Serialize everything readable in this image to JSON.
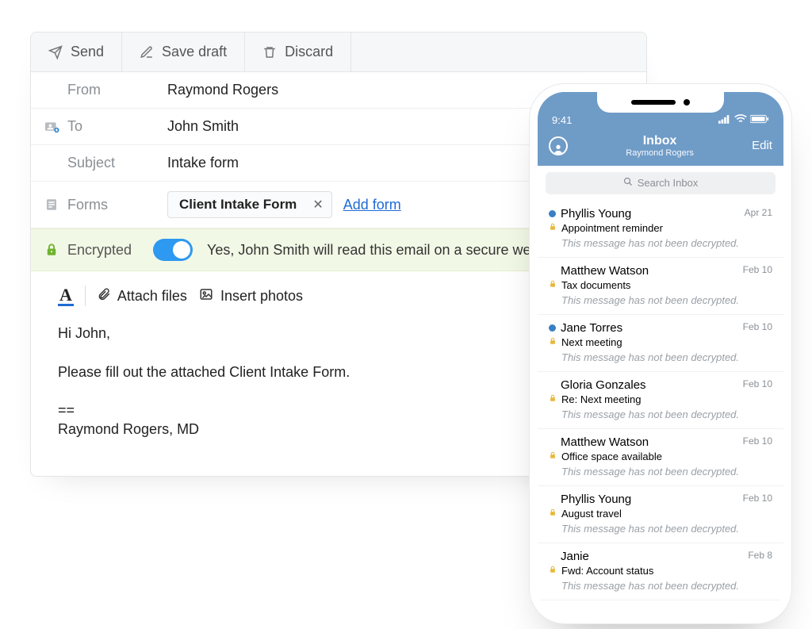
{
  "compose": {
    "toolbar": {
      "send": "Send",
      "save_draft": "Save draft",
      "discard": "Discard"
    },
    "labels": {
      "from": "From",
      "to": "To",
      "subject": "Subject",
      "forms": "Forms",
      "encrypted": "Encrypted"
    },
    "from_value": "Raymond Rogers",
    "to_value": "John Smith",
    "subject_value": "Intake form",
    "form_chip": "Client Intake Form",
    "add_form": "Add form",
    "encrypted_msg": "Yes, John Smith will read this email on a secure web pa",
    "editor": {
      "attach": "Attach files",
      "insert_photos": "Insert photos"
    },
    "body_line1": "Hi John,",
    "body_line2": "Please fill out the attached Client Intake Form.",
    "body_sep": "==",
    "body_sig": "Raymond Rogers, MD"
  },
  "phone": {
    "status_time": "9:41",
    "header_title": "Inbox",
    "header_subtitle": "Raymond Rogers",
    "edit_label": "Edit",
    "search_placeholder": "Search Inbox",
    "not_decrypted": "This message has not been decrypted.",
    "items": [
      {
        "sender": "Phyllis Young",
        "subject": "Appointment reminder",
        "date": "Apr 21",
        "unread": true
      },
      {
        "sender": "Matthew Watson",
        "subject": "Tax documents",
        "date": "Feb 10",
        "unread": false
      },
      {
        "sender": "Jane Torres",
        "subject": "Next meeting",
        "date": "Feb 10",
        "unread": true
      },
      {
        "sender": "Gloria Gonzales",
        "subject": "Re: Next meeting",
        "date": "Feb 10",
        "unread": false
      },
      {
        "sender": "Matthew Watson",
        "subject": "Office space available",
        "date": "Feb 10",
        "unread": false
      },
      {
        "sender": "Phyllis Young",
        "subject": "August travel",
        "date": "Feb 10",
        "unread": false
      },
      {
        "sender": "Janie",
        "subject": "Fwd: Account status",
        "date": "Feb 8",
        "unread": false
      }
    ]
  }
}
